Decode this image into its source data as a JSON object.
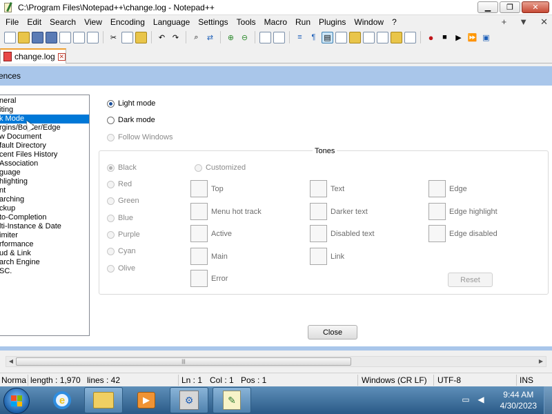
{
  "window": {
    "title": "C:\\Program Files\\Notepad++\\change.log - Notepad++",
    "minimize": "▁",
    "restore": "❐",
    "close": "✕"
  },
  "menu": {
    "items": [
      "File",
      "Edit",
      "Search",
      "View",
      "Encoding",
      "Language",
      "Settings",
      "Tools",
      "Macro",
      "Run",
      "Plugins",
      "Window",
      "?"
    ],
    "right": [
      "+",
      "▼",
      "✕"
    ]
  },
  "tab": {
    "label": "change.log",
    "close": "✕"
  },
  "dialog": {
    "title": "ences",
    "categories": [
      "neral",
      "iting",
      "k Mode",
      "rgins/Border/Edge",
      "w Document",
      "fault Directory",
      "cent Files History",
      " Association",
      "guage",
      "hlighting",
      "nt",
      "arching",
      "ckup",
      "to-Completion",
      "lti-Instance & Date",
      "imiter",
      "rformance",
      "ud & Link",
      "arch Engine",
      "SC."
    ],
    "selected_index": 2,
    "mode": {
      "light": "Light mode",
      "dark": "Dark mode",
      "follow": "Follow Windows"
    },
    "tones": {
      "legend": "Tones",
      "options": [
        "Black",
        "Red",
        "Green",
        "Blue",
        "Purple",
        "Cyan",
        "Olive"
      ],
      "customized": "Customized",
      "col1": [
        "Top",
        "Menu hot track",
        "Active",
        "Main",
        "Error"
      ],
      "col2": [
        "Text",
        "Darker text",
        "Disabled text",
        "Link"
      ],
      "col3": [
        "Edge",
        "Edge highlight",
        "Edge disabled"
      ],
      "reset": "Reset"
    },
    "close": "Close"
  },
  "scroll": {
    "left": "◀",
    "right": "▶",
    "grip": "|||"
  },
  "status": {
    "type": "Norma",
    "length": "length : 1,970",
    "lines": "lines : 42",
    "ln": "Ln : 1",
    "col": "Col : 1",
    "pos": "Pos : 1",
    "eol": "Windows (CR LF)",
    "encoding": "UTF-8",
    "ins": "INS"
  },
  "taskbar": {
    "ie_glyph": "e",
    "media_glyph": "▶",
    "setup_glyph": "⚙",
    "npp_glyph": "✎",
    "time": "9:44 AM",
    "date": "4/30/2023"
  },
  "colors": {
    "dialog_band": "#a9c6ea",
    "selection": "#0078d7",
    "taskbar": "#2a5a87"
  }
}
